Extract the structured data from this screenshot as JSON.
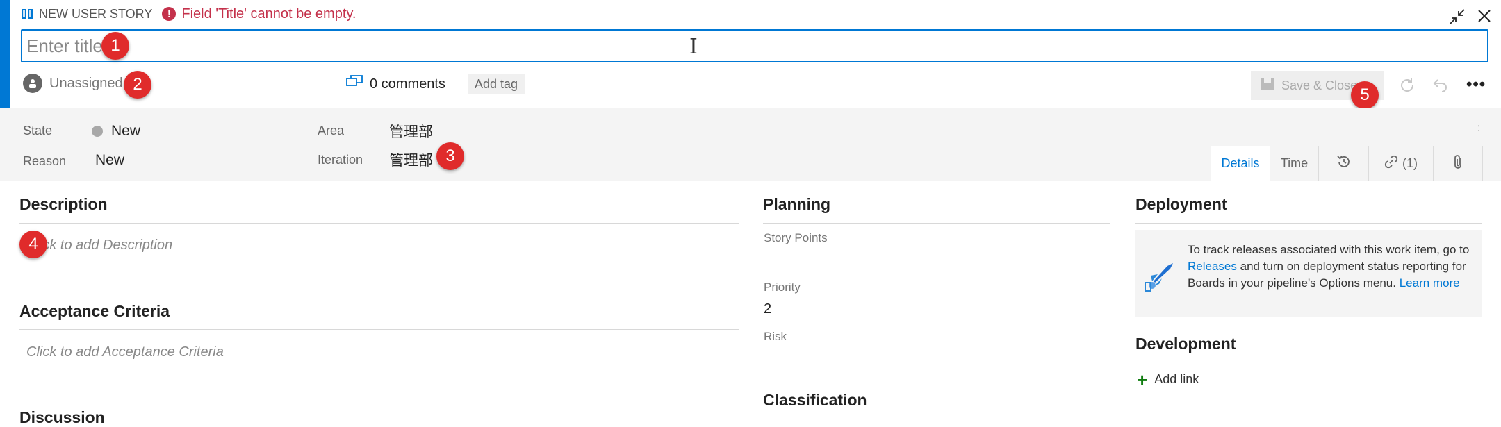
{
  "header": {
    "work_item_type": "NEW USER STORY",
    "error_message": "Field 'Title' cannot be empty."
  },
  "title_field": {
    "placeholder": "Enter title",
    "value": ""
  },
  "assignment": {
    "assigned_to": "Unassigned"
  },
  "comments": {
    "label": "0 comments"
  },
  "tags": {
    "add_tag_label": "Add tag"
  },
  "toolbar": {
    "save_close_label": "Save & Close",
    "more_label": "•••"
  },
  "fields": {
    "state": {
      "label": "State",
      "value": "New"
    },
    "reason": {
      "label": "Reason",
      "value": "New"
    },
    "area": {
      "label": "Area",
      "value": "管理部"
    },
    "iteration": {
      "label": "Iteration",
      "value": "管理部"
    },
    "kebab": ":"
  },
  "tabs": [
    {
      "label": "Details",
      "active": true
    },
    {
      "label": "Time",
      "active": false
    },
    {
      "label": "",
      "icon": "history-icon"
    },
    {
      "label": "(1)",
      "icon": "link-icon"
    },
    {
      "label": "",
      "icon": "attachment-icon"
    }
  ],
  "description": {
    "title": "Description",
    "placeholder": "Click to add Description"
  },
  "acceptance": {
    "title": "Acceptance Criteria",
    "placeholder": "Click to add Acceptance Criteria"
  },
  "discussion": {
    "title": "Discussion"
  },
  "planning": {
    "title": "Planning",
    "story_points_label": "Story Points",
    "priority_label": "Priority",
    "priority_value": "2",
    "risk_label": "Risk"
  },
  "classification": {
    "title": "Classification"
  },
  "deployment": {
    "title": "Deployment",
    "text_1": "To track releases associated with this work item, go to",
    "releases_link": "Releases",
    "text_2": "and turn on deployment status reporting for Boards in your pipeline's Options menu.",
    "learn_more_link": "Learn more"
  },
  "development": {
    "title": "Development",
    "add_link_label": "Add link"
  },
  "callouts": [
    "1",
    "2",
    "3",
    "4",
    "5"
  ],
  "colors": {
    "accent": "#0078d4",
    "error": "#c4314b",
    "callout": "#e02b2b",
    "add_green": "#107c10"
  }
}
